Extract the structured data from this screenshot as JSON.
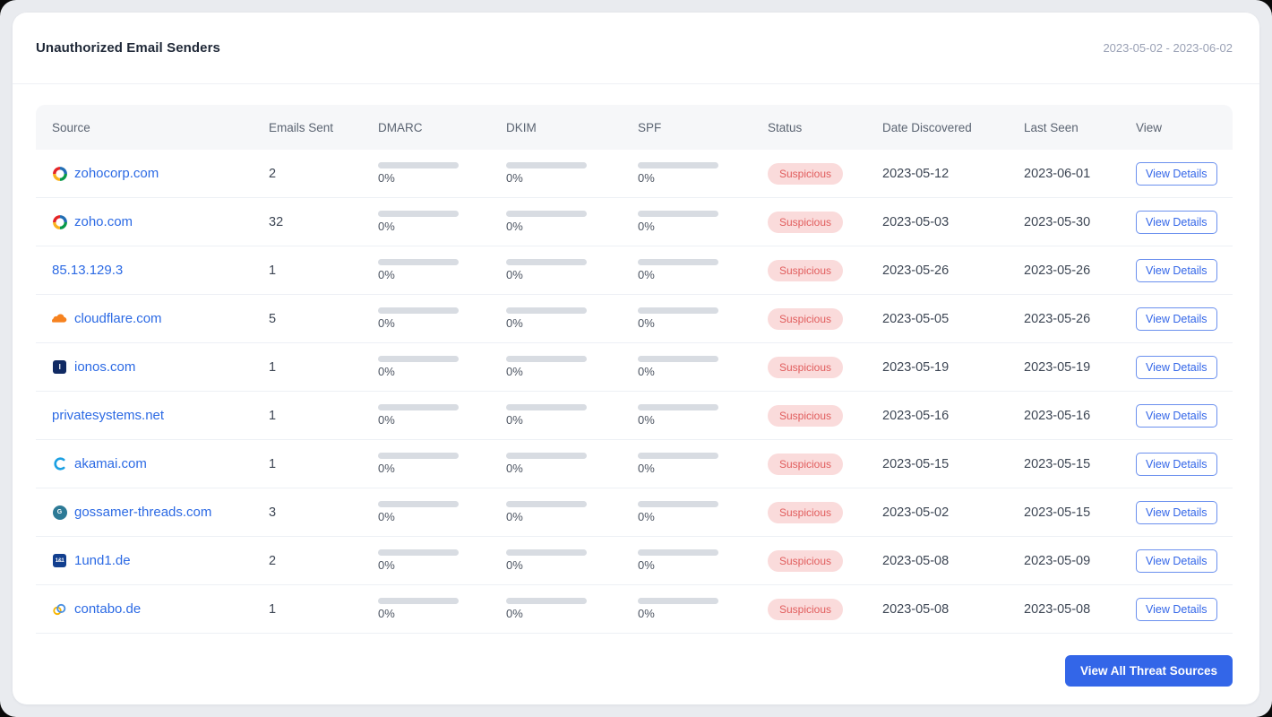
{
  "header": {
    "title": "Unauthorized Email Senders",
    "date_range": "2023-05-02 - 2023-06-02"
  },
  "table": {
    "columns": [
      "Source",
      "Emails Sent",
      "DMARC",
      "DKIM",
      "SPF",
      "Status",
      "Date Discovered",
      "Last Seen",
      "View"
    ],
    "rows": [
      {
        "source": "zohocorp.com",
        "icon": "zoho",
        "emails_sent": "2",
        "dmarc": "0%",
        "dkim": "0%",
        "spf": "0%",
        "status": "Suspicious",
        "date_discovered": "2023-05-12",
        "last_seen": "2023-06-01",
        "view": "View Details"
      },
      {
        "source": "zoho.com",
        "icon": "zoho",
        "emails_sent": "32",
        "dmarc": "0%",
        "dkim": "0%",
        "spf": "0%",
        "status": "Suspicious",
        "date_discovered": "2023-05-03",
        "last_seen": "2023-05-30",
        "view": "View Details"
      },
      {
        "source": "85.13.129.3",
        "icon": null,
        "emails_sent": "1",
        "dmarc": "0%",
        "dkim": "0%",
        "spf": "0%",
        "status": "Suspicious",
        "date_discovered": "2023-05-26",
        "last_seen": "2023-05-26",
        "view": "View Details"
      },
      {
        "source": "cloudflare.com",
        "icon": "cloudflare",
        "emails_sent": "5",
        "dmarc": "0%",
        "dkim": "0%",
        "spf": "0%",
        "status": "Suspicious",
        "date_discovered": "2023-05-05",
        "last_seen": "2023-05-26",
        "view": "View Details"
      },
      {
        "source": "ionos.com",
        "icon": "ionos",
        "emails_sent": "1",
        "dmarc": "0%",
        "dkim": "0%",
        "spf": "0%",
        "status": "Suspicious",
        "date_discovered": "2023-05-19",
        "last_seen": "2023-05-19",
        "view": "View Details"
      },
      {
        "source": "privatesystems.net",
        "icon": null,
        "emails_sent": "1",
        "dmarc": "0%",
        "dkim": "0%",
        "spf": "0%",
        "status": "Suspicious",
        "date_discovered": "2023-05-16",
        "last_seen": "2023-05-16",
        "view": "View Details"
      },
      {
        "source": "akamai.com",
        "icon": "akamai",
        "emails_sent": "1",
        "dmarc": "0%",
        "dkim": "0%",
        "spf": "0%",
        "status": "Suspicious",
        "date_discovered": "2023-05-15",
        "last_seen": "2023-05-15",
        "view": "View Details"
      },
      {
        "source": "gossamer-threads.com",
        "icon": "gossamer",
        "emails_sent": "3",
        "dmarc": "0%",
        "dkim": "0%",
        "spf": "0%",
        "status": "Suspicious",
        "date_discovered": "2023-05-02",
        "last_seen": "2023-05-15",
        "view": "View Details"
      },
      {
        "source": "1und1.de",
        "icon": "1und1",
        "emails_sent": "2",
        "dmarc": "0%",
        "dkim": "0%",
        "spf": "0%",
        "status": "Suspicious",
        "date_discovered": "2023-05-08",
        "last_seen": "2023-05-09",
        "view": "View Details"
      },
      {
        "source": "contabo.de",
        "icon": "contabo",
        "emails_sent": "1",
        "dmarc": "0%",
        "dkim": "0%",
        "spf": "0%",
        "status": "Suspicious",
        "date_discovered": "2023-05-08",
        "last_seen": "2023-05-08",
        "view": "View Details"
      }
    ]
  },
  "footer": {
    "view_all_label": "View All Threat Sources"
  },
  "colors": {
    "link_blue": "#2c6ae4",
    "badge_bg": "#fadbdb",
    "badge_text": "#e15d5d",
    "primary_button_bg": "#3366e8",
    "progress_track": "#d8dce2",
    "header_row_bg": "#f6f7f9",
    "page_bg": "#e9ebef"
  }
}
